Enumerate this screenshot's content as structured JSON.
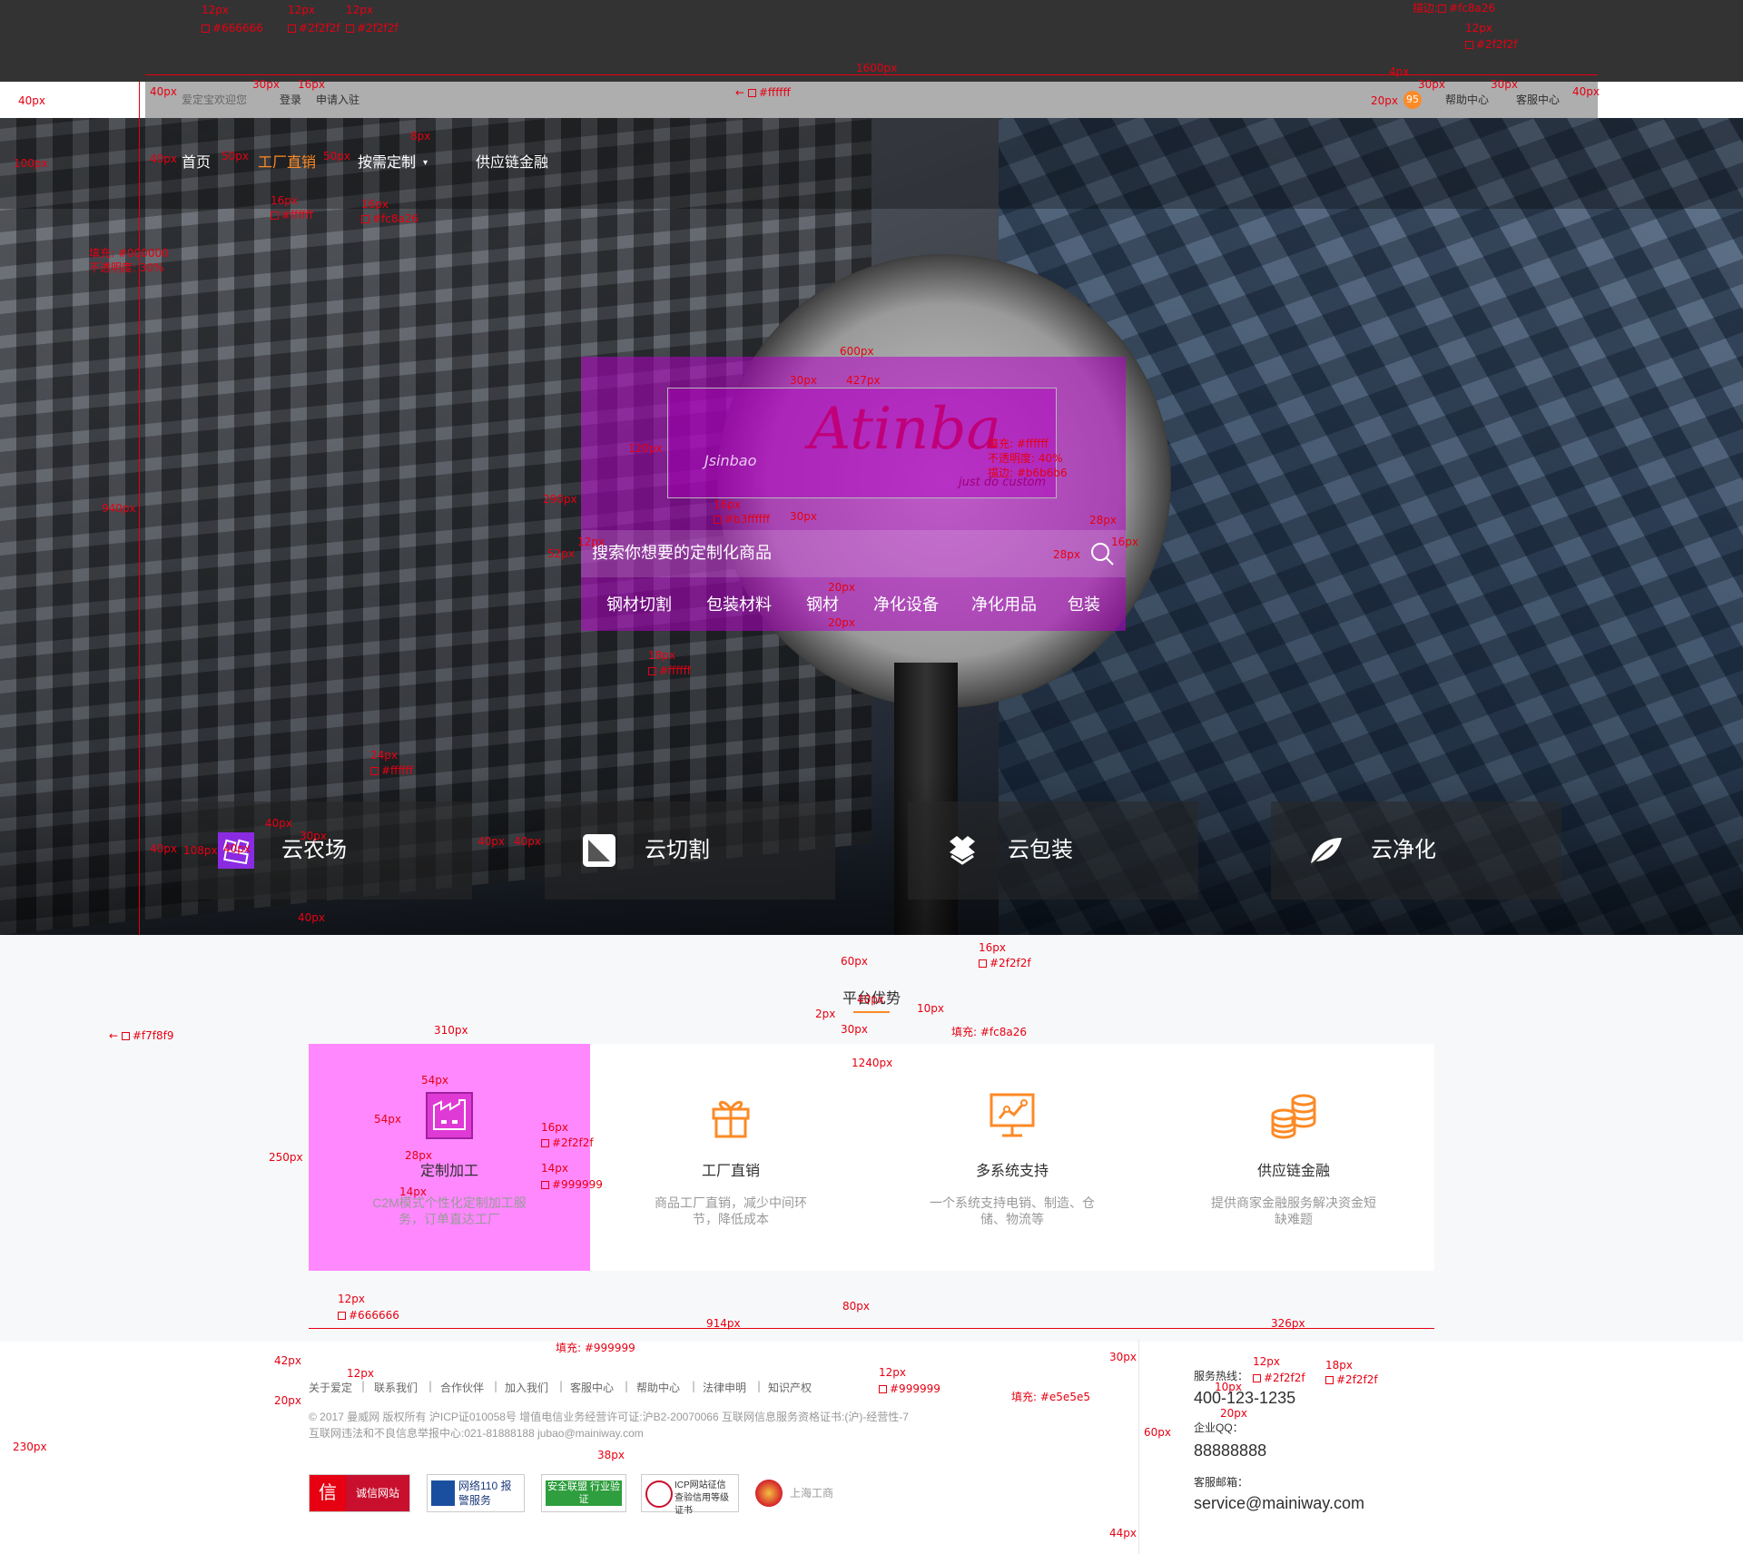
{
  "topbar": {
    "welcome": "爱定宝欢迎您",
    "login": "登录",
    "apply": "申请入驻",
    "cart_count": "95",
    "help": "帮助中心",
    "service": "客服中心"
  },
  "nav": {
    "items": [
      "首页",
      "工厂直销",
      "按需定制",
      "供应链金融"
    ]
  },
  "logo": {
    "brand": "Atinba",
    "sub": "Jsinbao",
    "slogan": "just do custom"
  },
  "search": {
    "placeholder": "搜索你想要的定制化商品",
    "hot": [
      "钢材切割",
      "包装材料",
      "钢材",
      "净化设备",
      "净化用品",
      "包装"
    ]
  },
  "services": [
    {
      "label": "云农场",
      "icon": "farm-icon"
    },
    {
      "label": "云切割",
      "icon": "cut-icon"
    },
    {
      "label": "云包装",
      "icon": "package-icon"
    },
    {
      "label": "云净化",
      "icon": "leaf-icon"
    }
  ],
  "advantages": {
    "title": "平台优势",
    "items": [
      {
        "title": "定制加工",
        "desc": "C2M模式个性化定制加工服务，订单直达工厂",
        "icon": "factory-icon"
      },
      {
        "title": "工厂直销",
        "desc": "商品工厂直销，减少中间环节，降低成本",
        "icon": "gift-icon"
      },
      {
        "title": "多系统支持",
        "desc": "一个系统支持电销、制造、仓储、物流等",
        "icon": "monitor-chart-icon"
      },
      {
        "title": "供应链金融",
        "desc": "提供商家金融服务解决资金短缺难题",
        "icon": "coins-icon"
      }
    ]
  },
  "footer": {
    "links": [
      "关于爱定",
      "联系我们",
      "合作伙伴",
      "加入我们",
      "客服中心",
      "帮助中心",
      "法律申明",
      "知识产权"
    ],
    "copyright": "© 2017 曼威网 版权所有 沪ICP证010058号   增值电信业务经营许可证:沪B2-20070066     互联网信息服务资格证书:(沪)-经营性-7",
    "report": "互联网违法和不良信息举报中心:021-81888188 jubao@mainiway.com",
    "badges": [
      "诚信网站",
      "网络110 报警服务",
      "安全联盟 行业验证",
      "ICP网站征信 查验信用等级证书",
      "上海工商"
    ],
    "hotline_label": "服务热线：",
    "hotline": "400-123-1235",
    "qq_label": "企业QQ：",
    "qq": "88888888",
    "email_label": "客服邮箱：",
    "email": "service@mainiway.com"
  },
  "annotations": {
    "top": [
      "12px",
      "#666666",
      "12px",
      "#2f2f2f",
      "12px",
      "#2f2f2f",
      "描边:",
      "#fc8a26",
      "12px",
      "#2f2f2f"
    ],
    "topbar_dims": [
      "40px",
      "30px",
      "16px",
      "1600px",
      "#ffffff",
      "4px",
      "30px",
      "30px",
      "20px",
      "40px"
    ],
    "left_dims": [
      "40px",
      "100px",
      "填充: #000000",
      "不透明度: 30%",
      "940px"
    ],
    "nav_dims": [
      "40px",
      "50px",
      "50px",
      "8px",
      "16px",
      "#ffffff",
      "16px",
      "#fc8a26"
    ],
    "search_dims": [
      "600px",
      "30px",
      "427px",
      "120px",
      "填充: #ffffff",
      "不透明度: 40%",
      "描边: #b6b6b6",
      "290px",
      "16px",
      "#b3ffffff",
      "30px",
      "52px",
      "12px",
      "28px",
      "28px",
      "16px",
      "20px",
      "20px",
      "18px",
      "#ffffff"
    ],
    "service_dims": [
      "24px",
      "#ffffff",
      "40px",
      "40px",
      "108px",
      "40px",
      "30px",
      "40px",
      "40px",
      "40px"
    ],
    "adv_dims": [
      "60px",
      "16px",
      "#2f2f2f",
      "2px",
      "40px",
      "10px",
      "30px",
      "填充: #fc8a26",
      "#f7f8f9",
      "310px",
      "1240px",
      "54px",
      "54px",
      "16px",
      "#2f2f2f",
      "250px",
      "28px",
      "14px",
      "14px",
      "#999999",
      "80px"
    ],
    "footer_dims": [
      "12px",
      "#666666",
      "914px",
      "326px",
      "42px",
      "12px",
      "填充: #999999",
      "20px",
      "12px",
      "#999999",
      "230px",
      "38px",
      "30px",
      "填充: #e5e5e5",
      "60px",
      "12px",
      "#2f2f2f",
      "18px",
      "#2f2f2f",
      "10px",
      "20px",
      "44px"
    ]
  }
}
